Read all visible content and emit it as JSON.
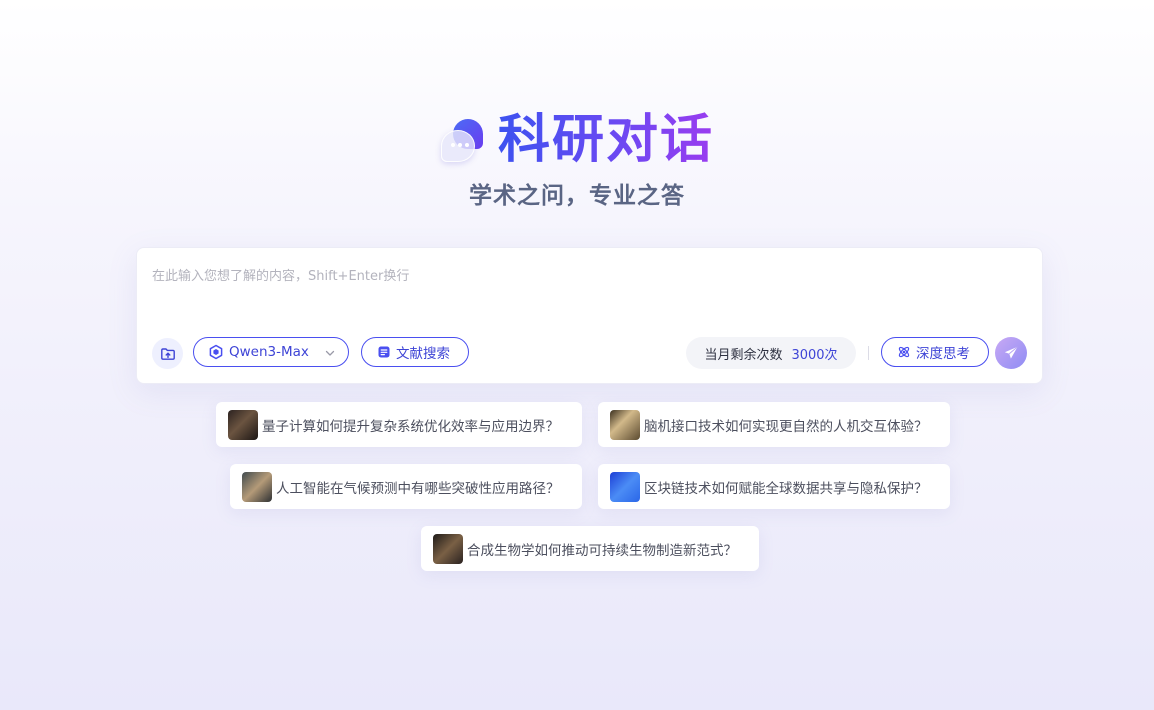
{
  "hero": {
    "title": "科研对话",
    "subtitle": "学术之问，专业之答",
    "logo_icon": "chat-bubbles-icon"
  },
  "chat": {
    "placeholder": "在此输入您想了解的内容，Shift+Enter换行",
    "model_label": "Qwen3-Max",
    "literature_label": "文献搜索",
    "quota_label": "当月剩余次数",
    "quota_value": "3000次",
    "deep_think_label": "深度思考"
  },
  "suggestions": [
    {
      "text": "量子计算如何提升复杂系统优化效率与应用边界？"
    },
    {
      "text": "脑机接口技术如何实现更自然的人机交互体验？"
    },
    {
      "text": "人工智能在气候预测中有哪些突破性应用路径？"
    },
    {
      "text": "区块链技术如何赋能全球数据共享与隐私保护？"
    },
    {
      "text": "合成生物学如何推动可持续生物制造新范式？"
    }
  ],
  "colors": {
    "accent": "#4a4ff0",
    "title_gradient_start": "#3d52f0",
    "title_gradient_end": "#9a3cf0",
    "subtitle": "#5a6584"
  }
}
